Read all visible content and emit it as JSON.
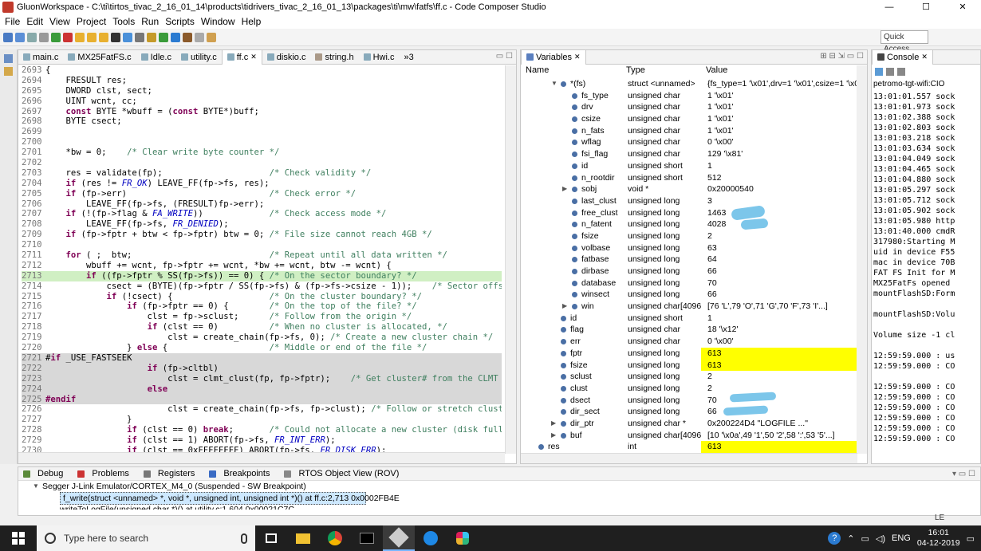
{
  "window": {
    "title": "GluonWorkspace - C:\\ti\\tirtos_tivac_2_16_01_14\\products\\tidrivers_tivac_2_16_01_13\\packages\\ti\\mw\\fatfs\\ff.c - Code Composer Studio",
    "minimize": "—",
    "maximize": "☐",
    "close": "✕"
  },
  "menu": [
    "File",
    "Edit",
    "View",
    "Project",
    "Tools",
    "Run",
    "Scripts",
    "Window",
    "Help"
  ],
  "toolbar": {
    "quick_access": "Quick Access"
  },
  "editor": {
    "tabs": [
      "main.c",
      "MX25FatFS.c",
      "Idle.c",
      "utility.c",
      "ff.c",
      "diskio.c",
      "string.h",
      "Hwi.c"
    ],
    "overflow": "»3",
    "lines": [
      {
        "n": "2693",
        "t": "{",
        "s": ""
      },
      {
        "n": "2694",
        "t": "    FRESULT res;",
        "s": ""
      },
      {
        "n": "2695",
        "t": "    DWORD clst, sect;",
        "s": ""
      },
      {
        "n": "2696",
        "t": "    UINT wcnt, cc;",
        "s": ""
      },
      {
        "n": "2697",
        "t": "    const BYTE *wbuff = (const BYTE*)buff;",
        "s": ""
      },
      {
        "n": "2698",
        "t": "    BYTE csect;",
        "s": ""
      },
      {
        "n": "2699",
        "t": "",
        "s": ""
      },
      {
        "n": "2700",
        "t": "",
        "s": ""
      },
      {
        "n": "2701",
        "t": "    *bw = 0;    /* Clear write byte counter */",
        "s": ""
      },
      {
        "n": "2702",
        "t": "",
        "s": ""
      },
      {
        "n": "2703",
        "t": "    res = validate(fp);                     /* Check validity */",
        "s": ""
      },
      {
        "n": "2704",
        "t": "    if (res != FR_OK) LEAVE_FF(fp->fs, res);",
        "s": ""
      },
      {
        "n": "2705",
        "t": "    if (fp->err)                            /* Check error */",
        "s": ""
      },
      {
        "n": "2706",
        "t": "        LEAVE_FF(fp->fs, (FRESULT)fp->err);",
        "s": ""
      },
      {
        "n": "2707",
        "t": "    if (!(fp->flag & FA_WRITE))             /* Check access mode */",
        "s": ""
      },
      {
        "n": "2708",
        "t": "        LEAVE_FF(fp->fs, FR_DENIED);",
        "s": ""
      },
      {
        "n": "2709",
        "t": "    if (fp->fptr + btw < fp->fptr) btw = 0; /* File size cannot reach 4GB */",
        "s": ""
      },
      {
        "n": "2710",
        "t": "",
        "s": ""
      },
      {
        "n": "2711",
        "t": "    for ( ;  btw;                           /* Repeat until all data written */",
        "s": ""
      },
      {
        "n": "2712",
        "t": "        wbuff += wcnt, fp->fptr += wcnt, *bw += wcnt, btw -= wcnt) {",
        "s": ""
      },
      {
        "n": "2713",
        "t": "        if ((fp->fptr % SS(fp->fs)) == 0) { /* On the sector boundary? */",
        "s": "cur"
      },
      {
        "n": "2714",
        "t": "            csect = (BYTE)(fp->fptr / SS(fp->fs) & (fp->fs->csize - 1));    /* Sector offset in the",
        "s": ""
      },
      {
        "n": "2715",
        "t": "            if (!csect) {                   /* On the cluster boundary? */",
        "s": ""
      },
      {
        "n": "2716",
        "t": "                if (fp->fptr == 0) {        /* On the top of the file? */",
        "s": ""
      },
      {
        "n": "2717",
        "t": "                    clst = fp->sclust;      /* Follow from the origin */",
        "s": ""
      },
      {
        "n": "2718",
        "t": "                    if (clst == 0)          /* When no cluster is allocated, */",
        "s": ""
      },
      {
        "n": "2719",
        "t": "                        clst = create_chain(fp->fs, 0); /* Create a new cluster chain */",
        "s": ""
      },
      {
        "n": "2720",
        "t": "                } else {                    /* Middle or end of the file */",
        "s": ""
      },
      {
        "n": "2721",
        "t": "#if _USE_FASTSEEK",
        "s": "inactive"
      },
      {
        "n": "2722",
        "t": "                    if (fp->cltbl)",
        "s": "inactive"
      },
      {
        "n": "2723",
        "t": "                        clst = clmt_clust(fp, fp->fptr);    /* Get cluster# from the CLMT */",
        "s": "inactive"
      },
      {
        "n": "2724",
        "t": "                    else",
        "s": "inactive"
      },
      {
        "n": "2725",
        "t": "#endif",
        "s": "inactive"
      },
      {
        "n": "2726",
        "t": "                        clst = create_chain(fp->fs, fp->clust); /* Follow or stretch cluster chain o",
        "s": ""
      },
      {
        "n": "2727",
        "t": "                }",
        "s": ""
      },
      {
        "n": "2728",
        "t": "                if (clst == 0) break;       /* Could not allocate a new cluster (disk full) */",
        "s": ""
      },
      {
        "n": "2729",
        "t": "                if (clst == 1) ABORT(fp->fs, FR_INT_ERR);",
        "s": ""
      },
      {
        "n": "2730",
        "t": "                if (clst == 0xFFFFFFFF) ABORT(fp->fs, FR_DISK_ERR);",
        "s": ""
      }
    ]
  },
  "variables": {
    "tab": "Variables",
    "columns": [
      "Name",
      "Type",
      "Value"
    ],
    "rows": [
      {
        "name": "*(fs)",
        "type": "struct <unnamed>",
        "value": "{fs_type=1 '\\x01',drv=1 '\\x01',csize=1 '\\x01',n",
        "indent": 2,
        "arrow": "down",
        "hl": false
      },
      {
        "name": "fs_type",
        "type": "unsigned char",
        "value": "1 '\\x01'",
        "indent": 3,
        "arrow": "",
        "hl": false
      },
      {
        "name": "drv",
        "type": "unsigned char",
        "value": "1 '\\x01'",
        "indent": 3,
        "arrow": "",
        "hl": false
      },
      {
        "name": "csize",
        "type": "unsigned char",
        "value": "1 '\\x01'",
        "indent": 3,
        "arrow": "",
        "hl": false
      },
      {
        "name": "n_fats",
        "type": "unsigned char",
        "value": "1 '\\x01'",
        "indent": 3,
        "arrow": "",
        "hl": false
      },
      {
        "name": "wflag",
        "type": "unsigned char",
        "value": "0 '\\x00'",
        "indent": 3,
        "arrow": "",
        "hl": false
      },
      {
        "name": "fsi_flag",
        "type": "unsigned char",
        "value": "129 '\\x81'",
        "indent": 3,
        "arrow": "",
        "hl": false
      },
      {
        "name": "id",
        "type": "unsigned short",
        "value": "1",
        "indent": 3,
        "arrow": "",
        "hl": false
      },
      {
        "name": "n_rootdir",
        "type": "unsigned short",
        "value": "512",
        "indent": 3,
        "arrow": "",
        "hl": false
      },
      {
        "name": "sobj",
        "type": "void *",
        "value": "0x20000540",
        "indent": 3,
        "arrow": "right",
        "hl": false
      },
      {
        "name": "last_clust",
        "type": "unsigned long",
        "value": "3",
        "indent": 3,
        "arrow": "",
        "hl": false
      },
      {
        "name": "free_clust",
        "type": "unsigned long",
        "value": "1463",
        "indent": 3,
        "arrow": "",
        "hl": false
      },
      {
        "name": "n_fatent",
        "type": "unsigned long",
        "value": "4028",
        "indent": 3,
        "arrow": "",
        "hl": false
      },
      {
        "name": "fsize",
        "type": "unsigned long",
        "value": "2",
        "indent": 3,
        "arrow": "",
        "hl": false
      },
      {
        "name": "volbase",
        "type": "unsigned long",
        "value": "63",
        "indent": 3,
        "arrow": "",
        "hl": false
      },
      {
        "name": "fatbase",
        "type": "unsigned long",
        "value": "64",
        "indent": 3,
        "arrow": "",
        "hl": false
      },
      {
        "name": "dirbase",
        "type": "unsigned long",
        "value": "66",
        "indent": 3,
        "arrow": "",
        "hl": false
      },
      {
        "name": "database",
        "type": "unsigned long",
        "value": "70",
        "indent": 3,
        "arrow": "",
        "hl": false
      },
      {
        "name": "winsect",
        "type": "unsigned long",
        "value": "66",
        "indent": 3,
        "arrow": "",
        "hl": false
      },
      {
        "name": "win",
        "type": "unsigned char[4096]",
        "value": "[76 'L',79 'O',71 'G',70 'F',73 'I'...]",
        "indent": 3,
        "arrow": "right",
        "hl": false
      },
      {
        "name": "id",
        "type": "unsigned short",
        "value": "1",
        "indent": 2,
        "arrow": "",
        "hl": false
      },
      {
        "name": "flag",
        "type": "unsigned char",
        "value": "18 '\\x12'",
        "indent": 2,
        "arrow": "",
        "hl": false
      },
      {
        "name": "err",
        "type": "unsigned char",
        "value": "0 '\\x00'",
        "indent": 2,
        "arrow": "",
        "hl": false
      },
      {
        "name": "fptr",
        "type": "unsigned long",
        "value": "613",
        "indent": 2,
        "arrow": "",
        "hl": true
      },
      {
        "name": "fsize",
        "type": "unsigned long",
        "value": "613",
        "indent": 2,
        "arrow": "",
        "hl": true
      },
      {
        "name": "sclust",
        "type": "unsigned long",
        "value": "2",
        "indent": 2,
        "arrow": "",
        "hl": false
      },
      {
        "name": "clust",
        "type": "unsigned long",
        "value": "2",
        "indent": 2,
        "arrow": "",
        "hl": false
      },
      {
        "name": "dsect",
        "type": "unsigned long",
        "value": "70",
        "indent": 2,
        "arrow": "",
        "hl": false
      },
      {
        "name": "dir_sect",
        "type": "unsigned long",
        "value": "66",
        "indent": 2,
        "arrow": "",
        "hl": false
      },
      {
        "name": "dir_ptr",
        "type": "unsigned char *",
        "value": "0x200224D4 \"LOGFILE   ...\"",
        "indent": 2,
        "arrow": "right",
        "hl": false
      },
      {
        "name": "buf",
        "type": "unsigned char[4096]",
        "value": "[10 '\\x0a',49 '1',50 '2',58 ':',53 '5'...]",
        "indent": 2,
        "arrow": "right",
        "hl": false
      },
      {
        "name": "res",
        "type": "int",
        "value": "613",
        "indent": 0,
        "arrow": "",
        "hl": true
      }
    ]
  },
  "console": {
    "tab": "Console",
    "target": "petromo-tgt-wifi:CIO",
    "lines": [
      "13:01:01.557 sock",
      "13:01:01.973 sock",
      "13:01:02.388 sock",
      "13:01:02.803 sock",
      "13:01:03.218 sock",
      "13:01:03.634 sock",
      "13:01:04.049 sock",
      "13:01:04.465 sock",
      "13:01:04.880 sock",
      "13:01:05.297 sock",
      "13:01:05.712 sock",
      "13:01:05.902 sock",
      "13:01:05.980 http",
      "13:01:40.000 cmdR",
      "317980:Starting M",
      "uid in device F55",
      "mac in device 70B",
      "FAT FS Init for M",
      "MX25FatFs opened",
      "mountFlashSD:Form",
      "",
      "mountFlashSD:Volu",
      "",
      "Volume size -1 cl",
      "",
      "12:59:59.000 : us",
      "12:59:59.000 : CO",
      "",
      "12:59:59.000 : CO",
      "12:59:59.000 : CO",
      "12:59:59.000 : CO",
      "12:59:59.000 : CO",
      "12:59:59.000 : CO",
      "12:59:59.000 : CO"
    ]
  },
  "debug": {
    "tabs": [
      "Debug",
      "Problems",
      "Registers",
      "Breakpoints",
      "RTOS Object View (ROV)"
    ],
    "session": "Segger J-Link Emulator/CORTEX_M4_0 (Suspended - SW Breakpoint)",
    "frame1": "f_write(struct <unnamed> *, void *, unsigned int, unsigned int *)() at ff.c:2,713 0x0002FB4E",
    "frame2": "writeToLogFile(unsigned char *)() at utility.c:1,604 0x00021C7C"
  },
  "status": {
    "le": "LE"
  },
  "taskbar": {
    "search_placeholder": "Type here to search",
    "lang": "ENG",
    "time": "16:01",
    "date": "04-12-2019"
  },
  "colors": {
    "highlight": "#ffff00",
    "current_line": "#d0efc3",
    "inactive_code": "#d8d8d8",
    "keyword": "#7f0055",
    "comment": "#3f7f5f"
  }
}
